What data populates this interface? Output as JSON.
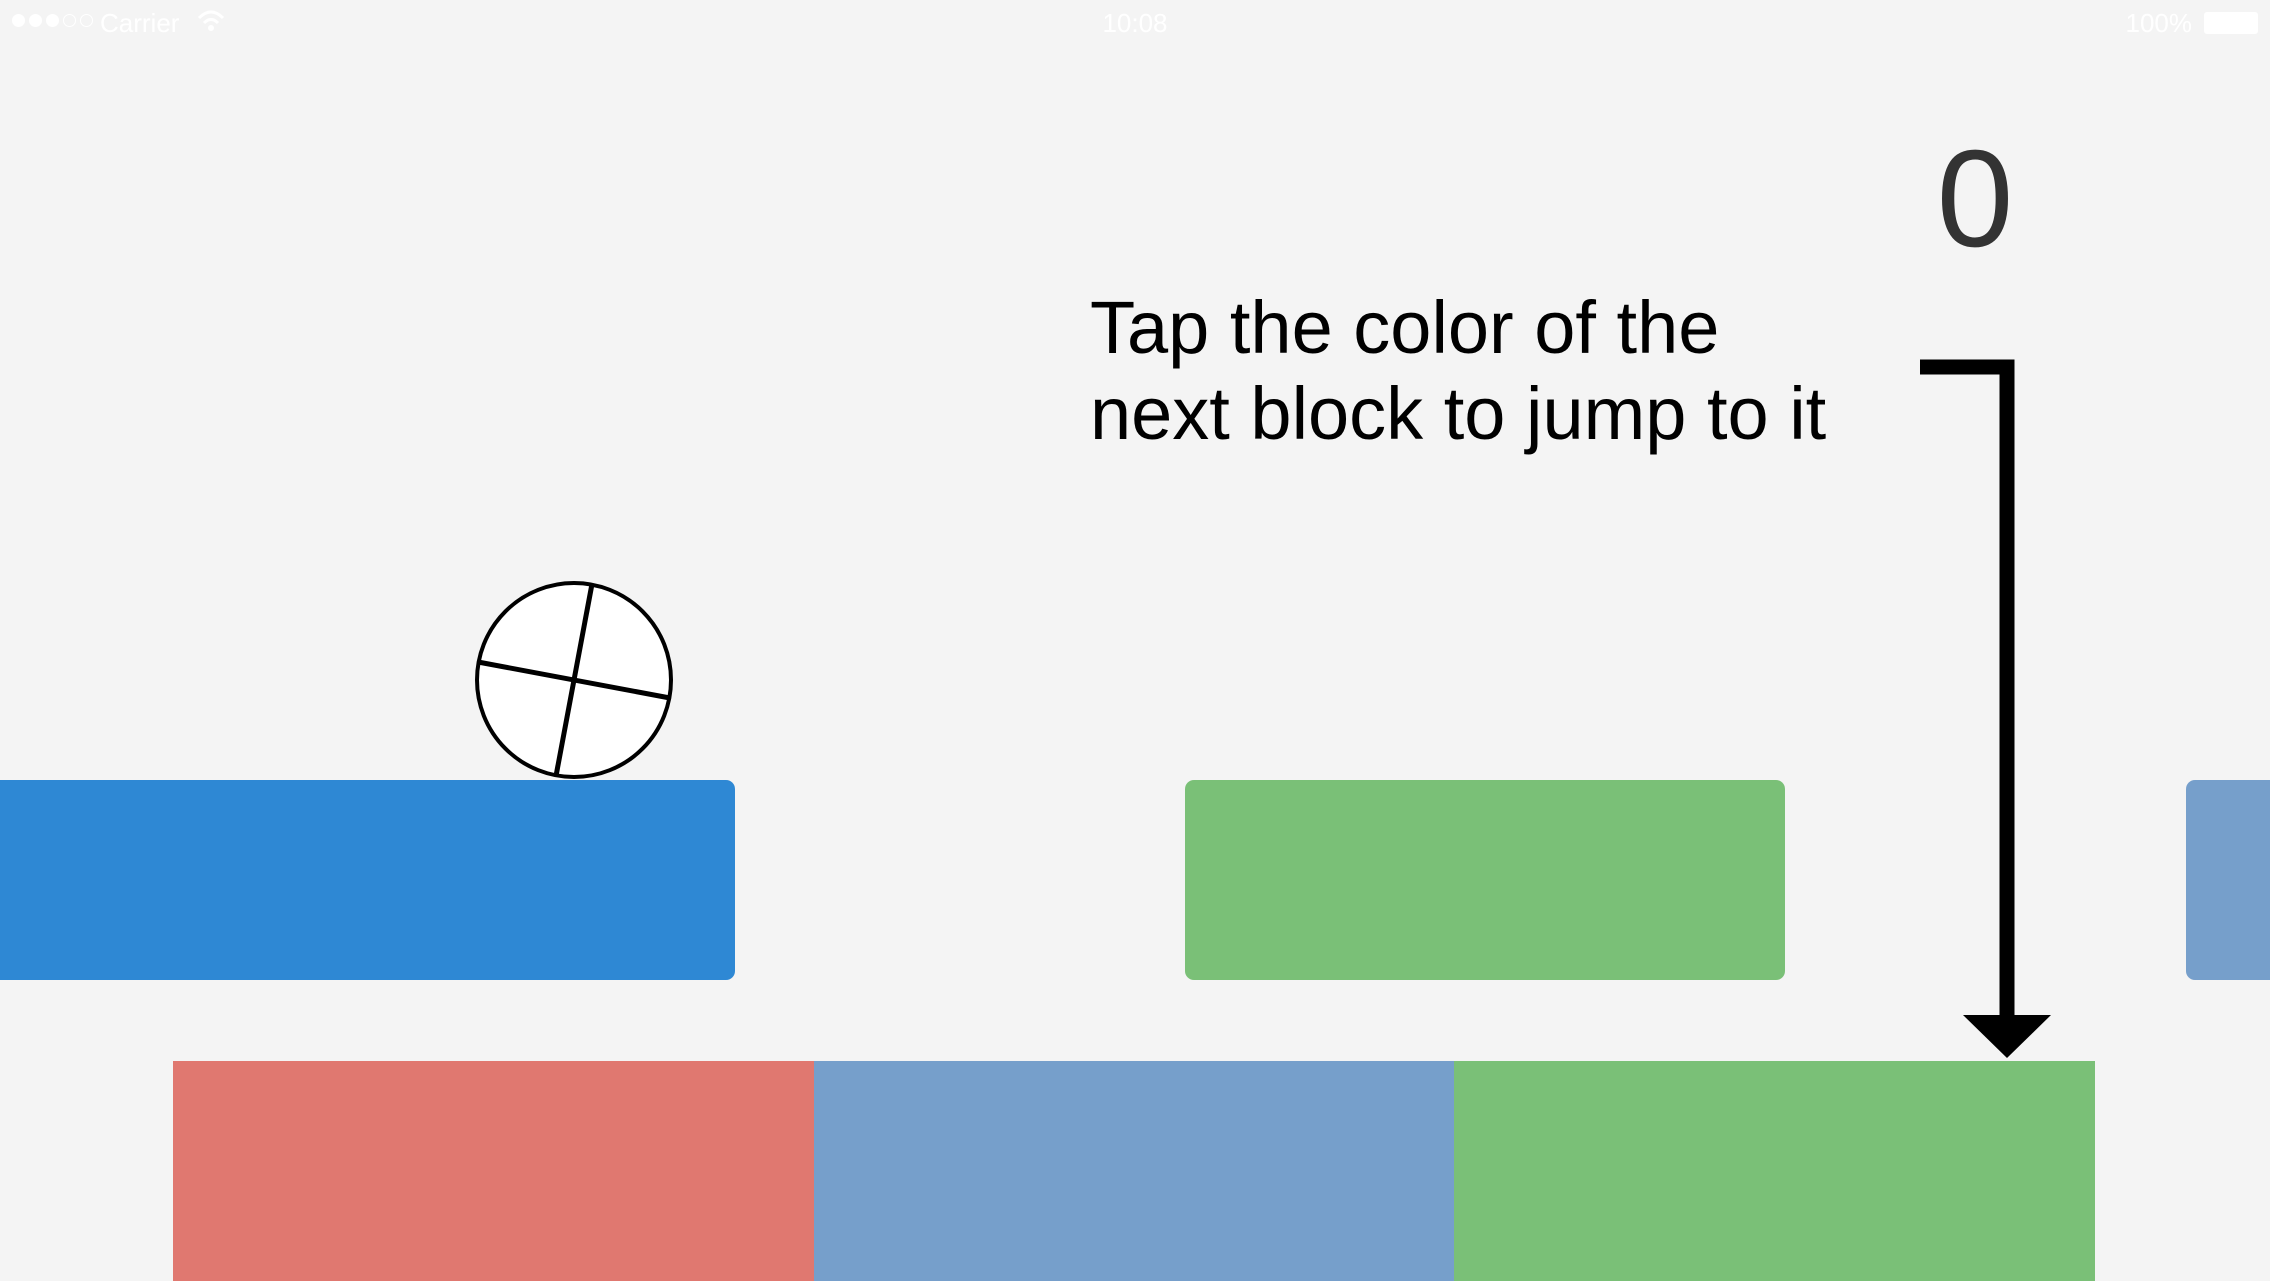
{
  "status_bar": {
    "carrier": "Carrier",
    "time": "10:08",
    "battery": "100%",
    "signal_icon": "signal-dots-icon",
    "wifi_icon": "wifi-icon",
    "battery_icon": "battery-icon"
  },
  "game": {
    "score": "0",
    "instruction_line1": "Tap the color of the",
    "instruction_line2": "next block to jump to it"
  },
  "colors": {
    "background": "#f4f4f4",
    "red": "#e07870",
    "blue_light": "#769fcb",
    "green": "#7ac077",
    "blue_platform": "#2e88d4",
    "score_text": "#333333"
  },
  "platforms": [
    {
      "name": "platform-blue-current",
      "color": "#2e88d4"
    },
    {
      "name": "platform-green-next",
      "color": "#7ac077"
    },
    {
      "name": "platform-blue-upcoming",
      "color": "#769fcb"
    }
  ],
  "color_buttons": [
    {
      "name": "color-button-red",
      "color": "#e07870"
    },
    {
      "name": "color-button-blue",
      "color": "#769fcb"
    },
    {
      "name": "color-button-green",
      "color": "#7ac077"
    }
  ]
}
